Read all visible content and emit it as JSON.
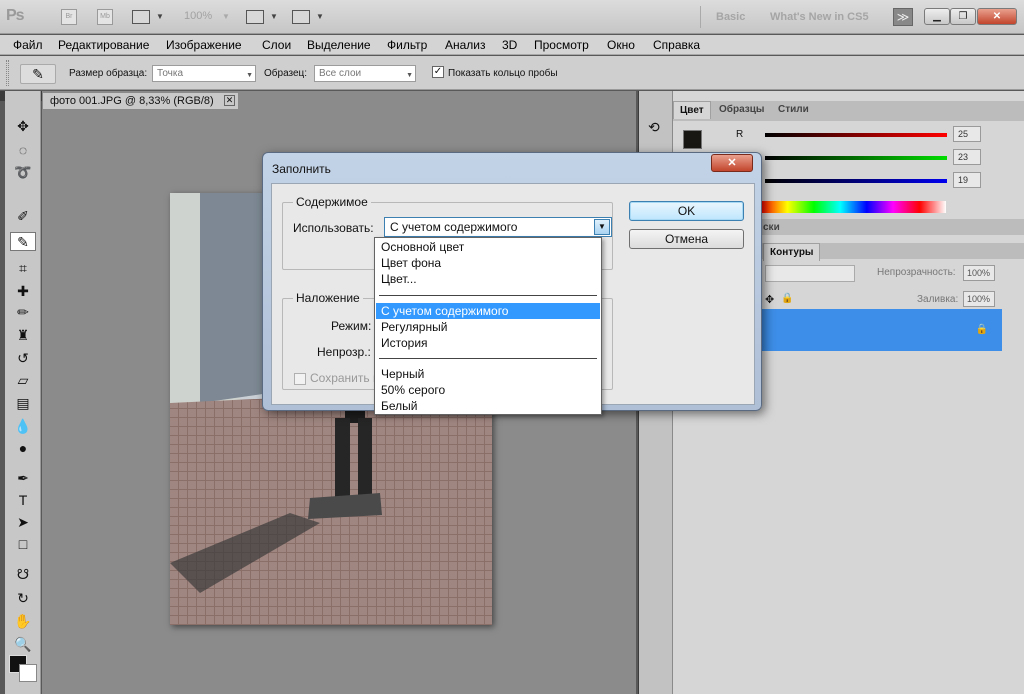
{
  "app": {
    "logo": "Ps",
    "bridge_label": "Br",
    "minibridge_label": "Mb",
    "zoom": "100%",
    "workspace_basic": "Basic",
    "workspace_new": "What's New in CS5",
    "more_symbol": "≫"
  },
  "menu": [
    "Файл",
    "Редактирование",
    "Изображение",
    "Слои",
    "Выделение",
    "Фильтр",
    "Анализ",
    "3D",
    "Просмотр",
    "Окно",
    "Справка"
  ],
  "options": {
    "sample_size_label": "Размер образца:",
    "sample_size_value": "Точка",
    "sample_label": "Образец:",
    "sample_value": "Все слои",
    "show_ring_label": "Показать кольцо пробы",
    "show_ring_checked": "✓"
  },
  "document": {
    "tab_title": "фото 001.JPG @ 8,33% (RGB/8)"
  },
  "panels": {
    "tabs": [
      "Цвет",
      "Образцы",
      "Стили"
    ],
    "r_label": "R",
    "r_value": "25",
    "g_value": "23",
    "b_value": "19",
    "fg_color": "#191713",
    "masks_tab": "ски",
    "paths_tab": "Контуры",
    "opacity_label": "Непрозрачность:",
    "opacity_value": "100%",
    "fill_label": "Заливка:",
    "fill_value": "100%"
  },
  "dialog": {
    "title": "Заполнить",
    "close_symbol": "✕",
    "contents_group": "Содержимое",
    "use_label": "Использовать:",
    "use_value": "С учетом содержимого",
    "blending_group": "Наложение",
    "mode_label": "Режим:",
    "opacity_label": "Непрозр.:",
    "preserve_label": "Сохранить п",
    "ok_label": "OK",
    "cancel_label": "Отмена",
    "options": [
      "Основной цвет",
      "Цвет фона",
      "Цвет...",
      "С учетом содержимого",
      "Регулярный",
      "История",
      "Черный",
      "50% серого",
      "Белый"
    ]
  },
  "colors": {
    "selection": "#3399ff",
    "layer_highlight": "#3d8ee8"
  }
}
